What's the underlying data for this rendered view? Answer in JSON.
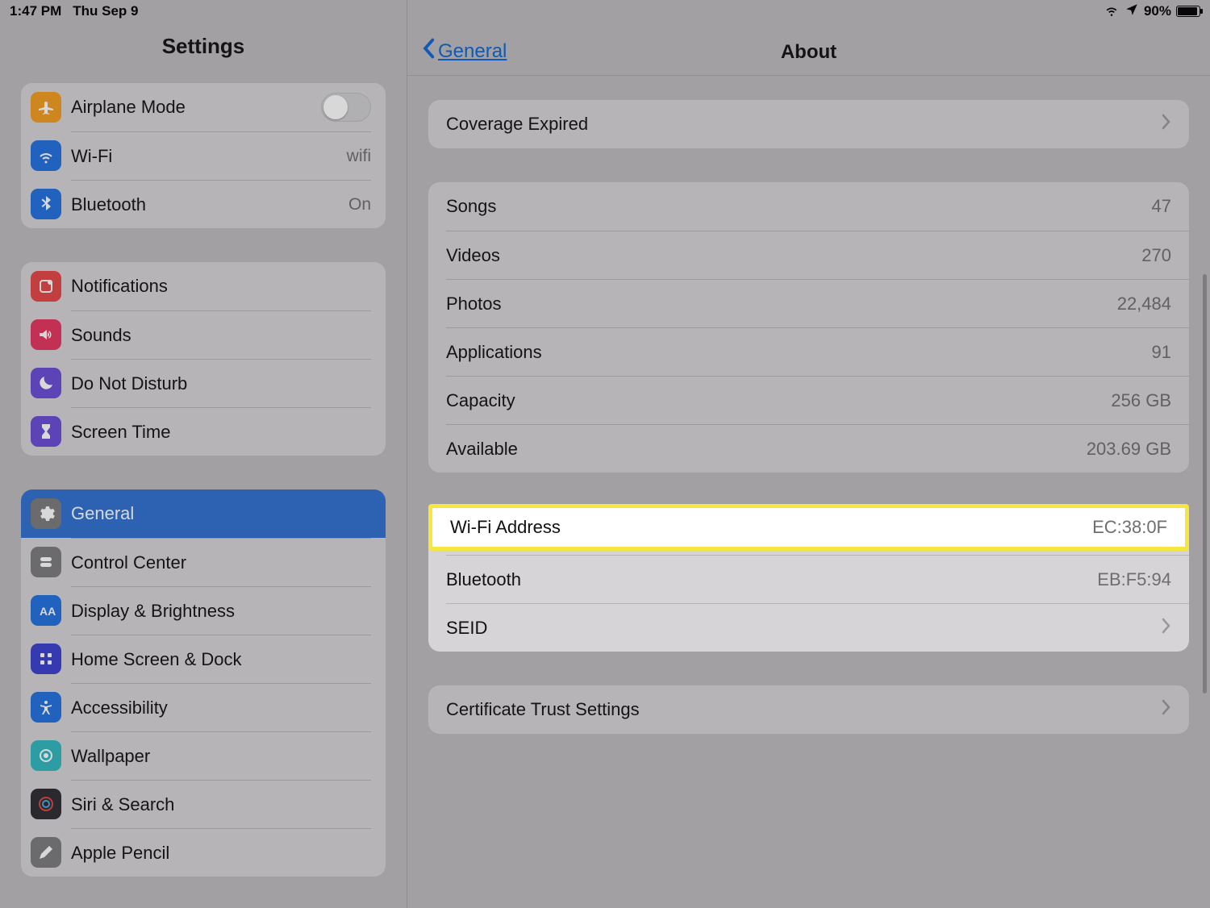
{
  "status": {
    "time": "1:47 PM",
    "date": "Thu Sep 9",
    "battery_pct": "90%"
  },
  "sidebar": {
    "title": "Settings",
    "group_connectivity": {
      "airplane": {
        "label": "Airplane Mode"
      },
      "wifi": {
        "label": "Wi-Fi",
        "value": "wifi"
      },
      "bluetooth": {
        "label": "Bluetooth",
        "value": "On"
      }
    },
    "group_notifications": {
      "notifications": {
        "label": "Notifications"
      },
      "sounds": {
        "label": "Sounds"
      },
      "dnd": {
        "label": "Do Not Disturb"
      },
      "screentime": {
        "label": "Screen Time"
      }
    },
    "group_general": {
      "general": {
        "label": "General"
      },
      "control_center": {
        "label": "Control Center"
      },
      "display": {
        "label": "Display & Brightness"
      },
      "home": {
        "label": "Home Screen & Dock"
      },
      "accessibility": {
        "label": "Accessibility"
      },
      "wallpaper": {
        "label": "Wallpaper"
      },
      "siri": {
        "label": "Siri & Search"
      },
      "pencil": {
        "label": "Apple Pencil"
      }
    }
  },
  "detail": {
    "back_label": "General",
    "title": "About",
    "coverage": {
      "label": "Coverage Expired"
    },
    "stats": {
      "songs": {
        "label": "Songs",
        "value": "47"
      },
      "videos": {
        "label": "Videos",
        "value": "270"
      },
      "photos": {
        "label": "Photos",
        "value": "22,484"
      },
      "applications": {
        "label": "Applications",
        "value": "91"
      },
      "capacity": {
        "label": "Capacity",
        "value": "256 GB"
      },
      "available": {
        "label": "Available",
        "value": "203.69 GB"
      }
    },
    "net": {
      "wifi_addr": {
        "label": "Wi-Fi Address",
        "value": "EC:38:0F"
      },
      "bt_addr": {
        "label": "Bluetooth",
        "value": "EB:F5:94"
      },
      "seid": {
        "label": "SEID"
      }
    },
    "cert": {
      "label": "Certificate Trust Settings"
    }
  }
}
